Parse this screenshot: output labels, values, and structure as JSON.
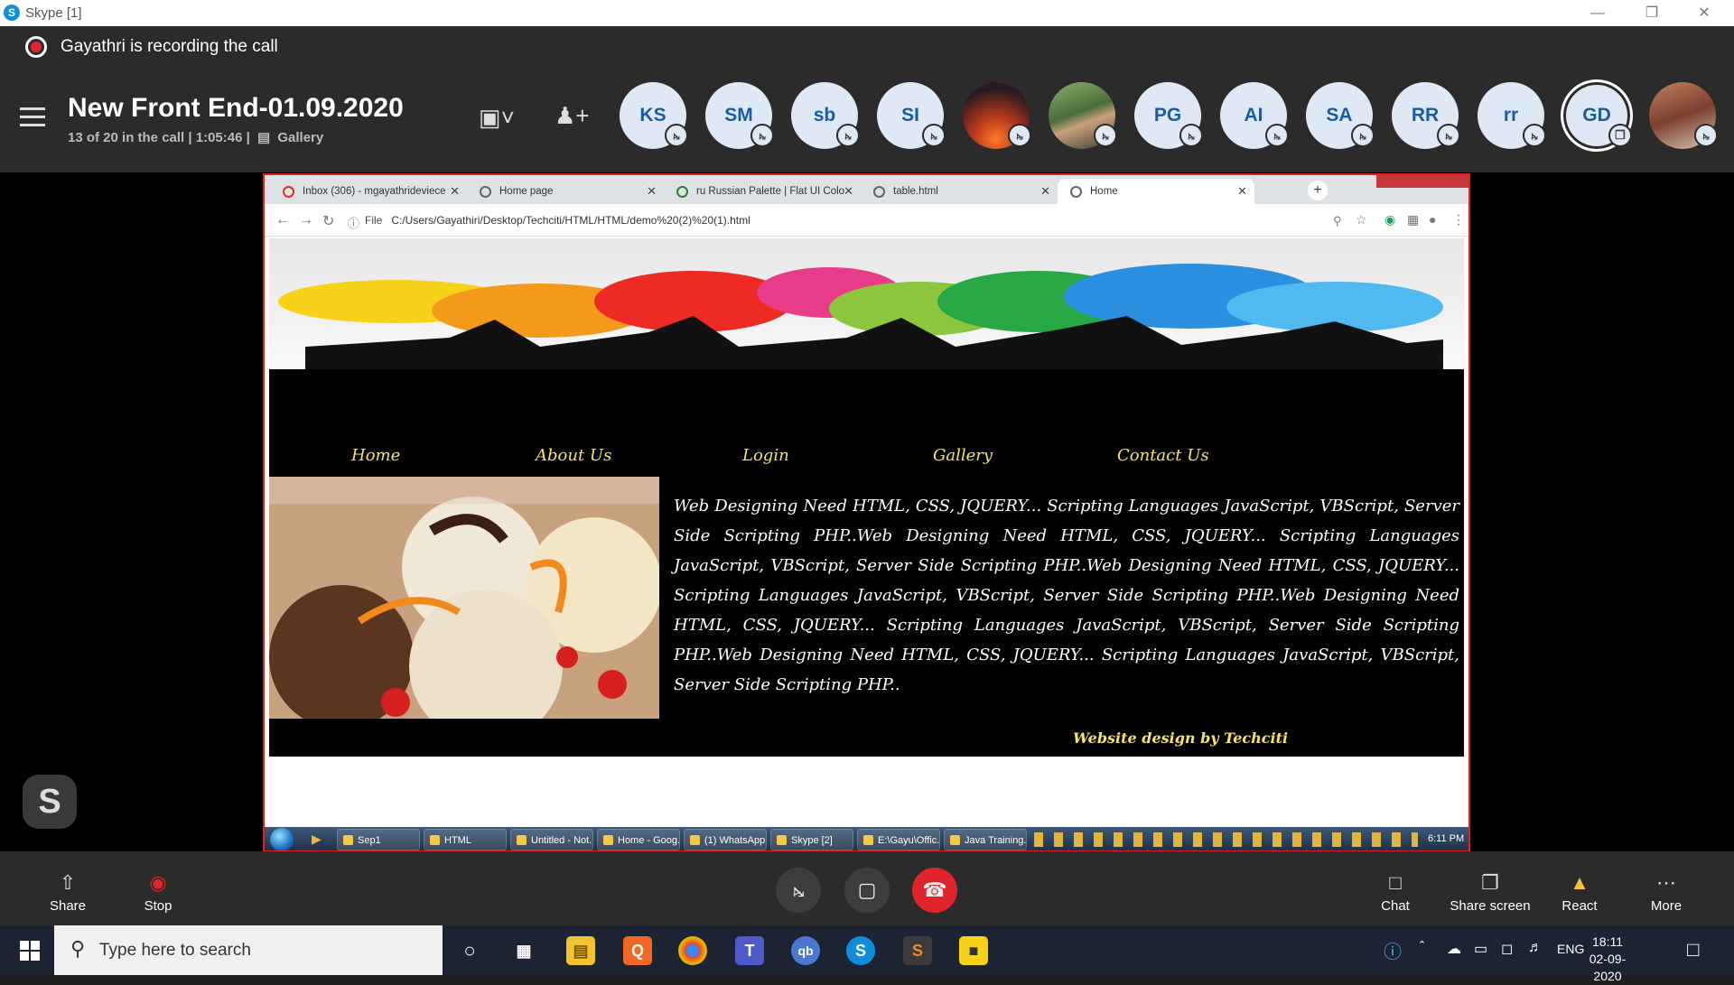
{
  "window": {
    "title": "Skype [1]"
  },
  "recording": {
    "text": "Gayathri is recording the call"
  },
  "meeting": {
    "title": "New Front End-01.09.2020",
    "subtitle": "13 of 20 in the call | 1:05:46 |",
    "view_mode": "Gallery"
  },
  "participants": [
    {
      "initials": "KS"
    },
    {
      "initials": "SM"
    },
    {
      "initials": "sb"
    },
    {
      "initials": "SI"
    },
    {
      "initials": ""
    },
    {
      "initials": ""
    },
    {
      "initials": "PG"
    },
    {
      "initials": "AI"
    },
    {
      "initials": "SA"
    },
    {
      "initials": "RR"
    },
    {
      "initials": "rr"
    },
    {
      "initials": "GD"
    },
    {
      "initials": ""
    }
  ],
  "browser": {
    "tabs": [
      {
        "label": "Inbox (306) - mgayathrideviece"
      },
      {
        "label": "Home page"
      },
      {
        "label": "ru Russian Palette | Flat UI Colo"
      },
      {
        "label": "table.html"
      },
      {
        "label": "Home"
      }
    ],
    "url_scheme": "File",
    "url": "C:/Users/Gayathiri/Desktop/Techciti/HTML/HTML/demo%20(2)%20(1).html"
  },
  "website": {
    "nav": [
      "Home",
      "About Us",
      "Login",
      "Gallery",
      "Contact Us"
    ],
    "about_text": "Web Designing Need HTML, CSS, JQUERY... Scripting Languages JavaScript, VBScript, Server Side Scripting PHP..Web Designing Need HTML, CSS, JQUERY... Scripting Languages JavaScript, VBScript, Server Side Scripting PHP..Web Designing Need HTML, CSS, JQUERY... Scripting Languages JavaScript, VBScript, Server Side Scripting PHP..Web Designing Need HTML, CSS, JQUERY... Scripting Languages JavaScript, VBScript, Server Side Scripting PHP..Web Designing Need HTML, CSS, JQUERY... Scripting Languages JavaScript, VBScript, Server Side Scripting PHP..",
    "credit": "Website design by Techciti"
  },
  "remote_taskbar": {
    "buttons": [
      "Sep1",
      "HTML",
      "Untitled - Not...",
      "Home - Goog...",
      "(1) WhatsApp...",
      "Skype [2]",
      "E:\\Gayu\\Offic...",
      "Java Training..."
    ],
    "time": "6:11 PM"
  },
  "controls": {
    "share": "Share",
    "stop": "Stop",
    "chat": "Chat",
    "share_screen": "Share screen",
    "react": "React",
    "more": "More"
  },
  "taskbar": {
    "search_placeholder": "Type here to search",
    "language": "ENG",
    "time": "18:11",
    "date": "02-09-2020"
  },
  "colors": {
    "accent": "#f7e463",
    "record": "#e0242c",
    "share_border": "#e02020"
  }
}
